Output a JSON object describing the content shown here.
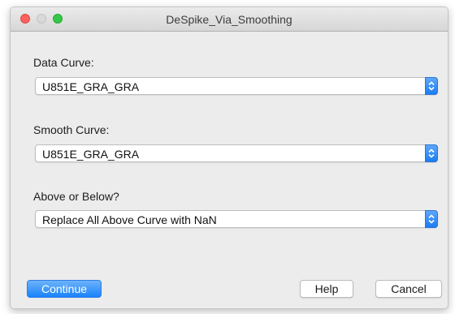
{
  "window": {
    "title": "DeSpike_Via_Smoothing"
  },
  "fields": [
    {
      "label": "Data Curve:",
      "value": "U851E_GRA_GRA"
    },
    {
      "label": "Smooth Curve:",
      "value": "U851E_GRA_GRA"
    },
    {
      "label": "Above or Below?",
      "value": "Replace All Above Curve with NaN"
    }
  ],
  "buttons": {
    "continue": "Continue",
    "help": "Help",
    "cancel": "Cancel"
  },
  "colors": {
    "accent": "#1a82fb",
    "close": "#fc615d",
    "zoom": "#34c748"
  }
}
